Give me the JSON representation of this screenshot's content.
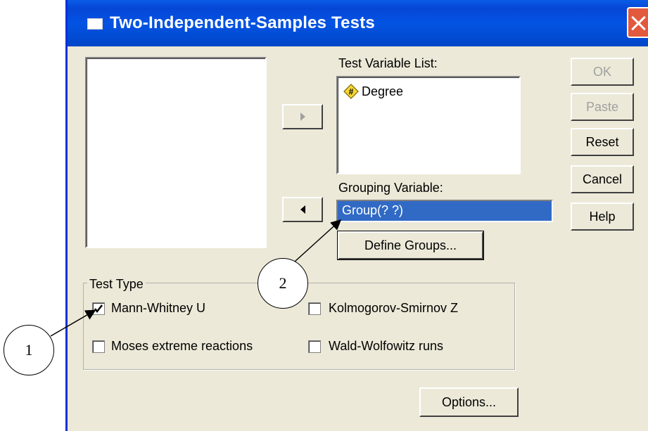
{
  "window": {
    "title": "Two-Independent-Samples Tests"
  },
  "test_variable_list": {
    "label": "Test Variable List:",
    "items": [
      {
        "icon": "scale-variable-icon",
        "text": "Degree"
      }
    ]
  },
  "grouping_variable": {
    "label": "Grouping Variable:",
    "value": "Group(? ?)"
  },
  "buttons": {
    "define_groups": "Define Groups...",
    "ok": "OK",
    "paste": "Paste",
    "reset": "Reset",
    "cancel": "Cancel",
    "help": "Help",
    "options": "Options..."
  },
  "test_type": {
    "label": "Test Type",
    "options": [
      {
        "label": "Mann-Whitney U",
        "checked": true
      },
      {
        "label": "Kolmogorov-Smirnov Z",
        "checked": false
      },
      {
        "label": "Moses extreme reactions",
        "checked": false
      },
      {
        "label": "Wald-Wolfowitz runs",
        "checked": false
      }
    ]
  },
  "annotations": {
    "one": "1",
    "two": "2"
  }
}
